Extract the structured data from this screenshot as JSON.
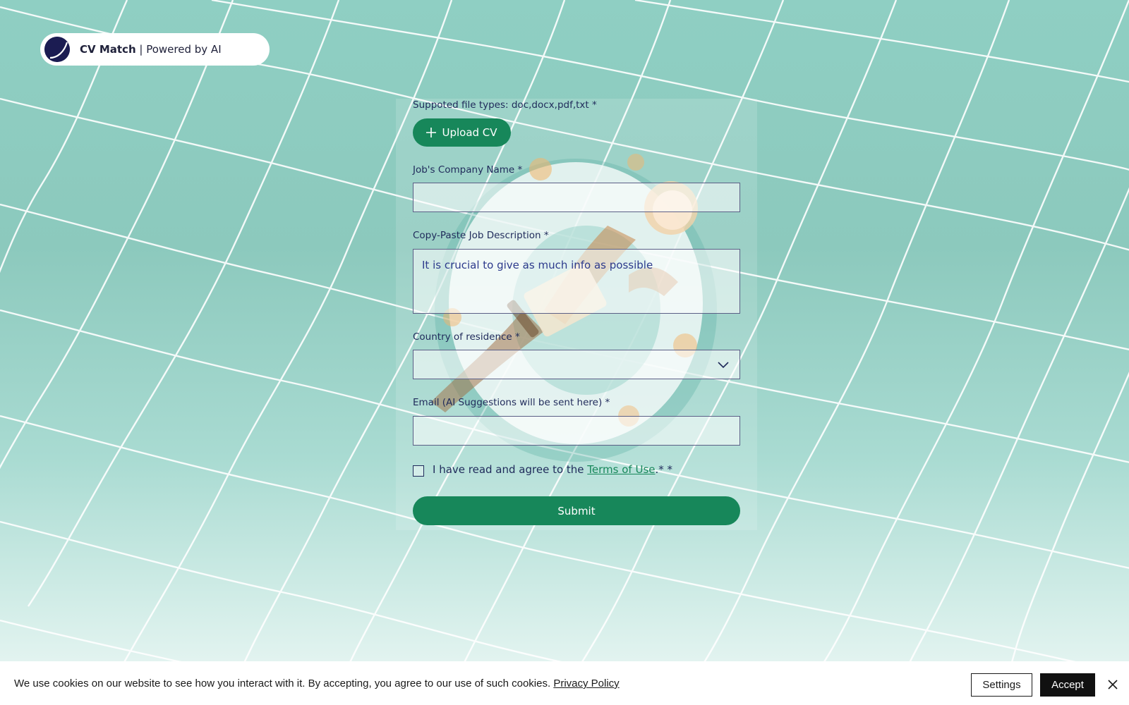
{
  "brand": {
    "name": "CV Match",
    "tagline": " | Powered by AI"
  },
  "form": {
    "upload_label": "Suppoted file types: doc,docx,pdf,txt *",
    "upload_button": "Upload CV",
    "company_label": "Job's Company Name *",
    "company_value": "",
    "description_label": "Copy-Paste Job Description *",
    "description_placeholder": "It is crucial to give as much info as possible",
    "country_label": "Country of residence *",
    "country_value": "",
    "email_label": "Email (AI Suggestions will be sent here) *",
    "email_value": "",
    "terms_prefix": "I have read and agree to the ",
    "terms_link": "Terms of Use",
    "terms_suffix": ".* *",
    "submit_label": "Submit"
  },
  "cookie_banner": {
    "text": "We use cookies on our website to see how you interact with it. By accepting, you agree to our use of such cookies. ",
    "policy_link": "Privacy Policy",
    "settings_label": "Settings",
    "accept_label": "Accept"
  },
  "colors": {
    "accent": "#17875a",
    "brand_logo": "#1b1c52",
    "text_dark": "#1f2a5a"
  },
  "icons": {
    "upload": "plus-icon",
    "select": "chevron-down-icon",
    "close": "close-icon"
  }
}
